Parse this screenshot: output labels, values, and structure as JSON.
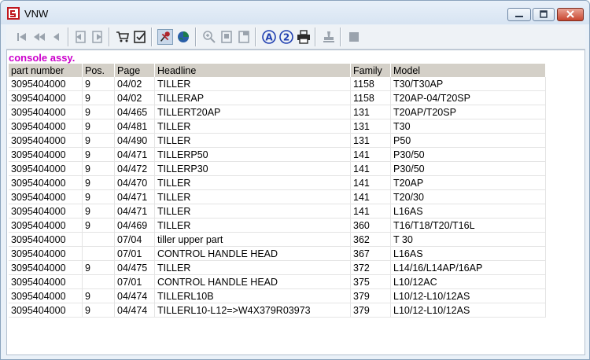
{
  "window": {
    "title": "VNW"
  },
  "toolbar": {
    "buttons": [
      {
        "name": "first-record-icon",
        "color": "#9aa3ad"
      },
      {
        "name": "previous-page-icon",
        "color": "#9aa3ad"
      },
      {
        "name": "previous-record-icon",
        "color": "#9aa3ad"
      },
      {
        "name": "back-document-icon",
        "color": "#9aa3ad"
      },
      {
        "name": "forward-document-icon",
        "color": "#9aa3ad"
      },
      {
        "name": "shopping-cart-icon",
        "color": "#2a2a2a"
      },
      {
        "name": "clipboard-check-icon",
        "color": "#2a2a2a"
      },
      {
        "name": "pin-marker-icon",
        "color": "#b0242b"
      },
      {
        "name": "globe-icon",
        "color": "#1d7d4b"
      },
      {
        "name": "zoom-in-icon",
        "color": "#9aa3ad"
      },
      {
        "name": "page-fit-icon",
        "color": "#9aa3ad"
      },
      {
        "name": "page-view-icon",
        "color": "#9aa3ad"
      },
      {
        "name": "letter-a-icon",
        "color": "#1f3fb0"
      },
      {
        "name": "number-2-icon",
        "color": "#1f3fb0"
      },
      {
        "name": "printer-icon",
        "color": "#2a2a2a"
      },
      {
        "name": "stamp-icon",
        "color": "#9aa3ad"
      },
      {
        "name": "stop-icon",
        "color": "#9aa3ad"
      }
    ]
  },
  "content": {
    "section_title": "console assy.",
    "columns": [
      "part number",
      "Pos.",
      "Page",
      "Headline",
      "Family",
      "Model"
    ],
    "rows": [
      {
        "part": "3095404000",
        "pos": "9",
        "page": "04/02",
        "headline": "TILLER",
        "headline_extra": "",
        "family": "1158",
        "model": "T30/T30AP"
      },
      {
        "part": "3095404000",
        "pos": "9",
        "page": "04/02",
        "headline": "TILLER",
        "headline_extra": "AP",
        "family": "1158",
        "model": "T20AP-04/T20SP"
      },
      {
        "part": "3095404000",
        "pos": "9",
        "page": "04/465",
        "headline": "TILLER",
        "headline_extra": "T20AP",
        "family": "131",
        "model": "T20AP/T20SP"
      },
      {
        "part": "3095404000",
        "pos": "9",
        "page": "04/481",
        "headline": "TILLER",
        "headline_extra": "",
        "family": "131",
        "model": "T30"
      },
      {
        "part": "3095404000",
        "pos": "9",
        "page": "04/490",
        "headline": "TILLER",
        "headline_extra": "",
        "family": "131",
        "model": "P50"
      },
      {
        "part": "3095404000",
        "pos": "9",
        "page": "04/471",
        "headline": "TILLER",
        "headline_extra": "P50",
        "family": "141",
        "model": "P30/50"
      },
      {
        "part": "3095404000",
        "pos": "9",
        "page": "04/472",
        "headline": "TILLER",
        "headline_extra": "P30",
        "family": "141",
        "model": "P30/50"
      },
      {
        "part": "3095404000",
        "pos": "9",
        "page": "04/470",
        "headline": "TILLER",
        "headline_extra": "",
        "family": "141",
        "model": "T20AP"
      },
      {
        "part": "3095404000",
        "pos": "9",
        "page": "04/471",
        "headline": "TILLER",
        "headline_extra": "",
        "family": "141",
        "model": "T20/30"
      },
      {
        "part": "3095404000",
        "pos": "9",
        "page": "04/471",
        "headline": "TILLER",
        "headline_extra": "",
        "family": "141",
        "model": "L16AS"
      },
      {
        "part": "3095404000",
        "pos": "9",
        "page": "04/469",
        "headline": "TILLER",
        "headline_extra": "",
        "family": "360",
        "model": "T16/T18/T20/T16L"
      },
      {
        "part": "3095404000",
        "pos": "",
        "page": "07/04",
        "headline": "tiller upper part",
        "headline_extra": "",
        "family": "362",
        "model": "T 30"
      },
      {
        "part": "3095404000",
        "pos": "",
        "page": "07/01",
        "headline": "CONTROL HANDLE HEAD",
        "headline_extra": "",
        "family": "367",
        "model": "L16AS"
      },
      {
        "part": "3095404000",
        "pos": "9",
        "page": "04/475",
        "headline": "TILLER",
        "headline_extra": "",
        "family": "372",
        "model": "L14/16/L14AP/16AP"
      },
      {
        "part": "3095404000",
        "pos": "",
        "page": "07/01",
        "headline": "CONTROL HANDLE HEAD",
        "headline_extra": "",
        "family": "375",
        "model": "L10/12AC"
      },
      {
        "part": "3095404000",
        "pos": "9",
        "page": "04/474",
        "headline": "TILLER",
        "headline_extra": "L10B",
        "family": "379",
        "model": "L10/12-L10/12AS"
      },
      {
        "part": "3095404000",
        "pos": "9",
        "page": "04/474",
        "headline": "TILLER",
        "headline_extra": "L10-L12=>W4X379R03973",
        "family": "379",
        "model": "L10/12-L10/12AS"
      }
    ]
  }
}
